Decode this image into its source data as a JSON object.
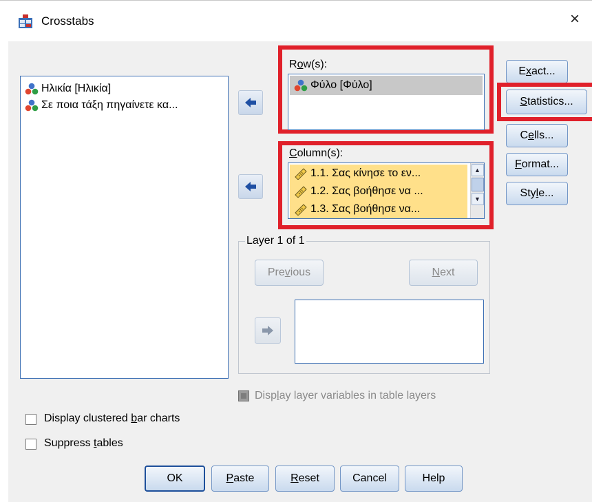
{
  "window": {
    "title": "Crosstabs",
    "close_glyph": "×"
  },
  "source_list": {
    "items": [
      {
        "label": "Ηλικία [Ηλικία]",
        "icon": "nominal-variable-icon"
      },
      {
        "label": "Σε ποια τάξη πηγαίνετε κα...",
        "icon": "nominal-variable-icon"
      }
    ]
  },
  "rows": {
    "label_pre": "R",
    "label_ul": "o",
    "label_post": "w(s):",
    "items": [
      {
        "label": "Φύλο [Φύλο]",
        "icon": "nominal-variable-icon",
        "selected": true
      }
    ]
  },
  "columns": {
    "label_pre": "",
    "label_ul": "C",
    "label_post": "olumn(s):",
    "items": [
      {
        "label": "1.1. Σας κίνησε το εν...",
        "icon": "scale-ruler-icon"
      },
      {
        "label": "1.2. Σας βοήθησε να ...",
        "icon": "scale-ruler-icon"
      },
      {
        "label": "1.3. Σας βοήθησε να...",
        "icon": "scale-ruler-icon"
      }
    ]
  },
  "side_buttons": {
    "exact": {
      "pre": "E",
      "ul": "x",
      "post": "act..."
    },
    "statistics": {
      "pre": "",
      "ul": "S",
      "post": "tatistics..."
    },
    "cells": {
      "pre": "C",
      "ul": "e",
      "post": "lls..."
    },
    "format": {
      "pre": "",
      "ul": "F",
      "post": "ormat..."
    },
    "style": {
      "pre": "Sty",
      "ul": "l",
      "post": "e..."
    }
  },
  "layer": {
    "title": "Layer 1 of 1",
    "previous": {
      "pre": "Pre",
      "ul": "v",
      "post": "ious"
    },
    "next": {
      "pre": "",
      "ul": "N",
      "post": "ext"
    }
  },
  "options": {
    "display_layer": {
      "pre": "Disp",
      "ul": "l",
      "post": "ay layer variables in table layers",
      "checked": false,
      "enabled": false
    },
    "clustered_bar": {
      "pre": "Display clustered ",
      "ul": "b",
      "post": "ar charts",
      "checked": false
    },
    "suppress_tables": {
      "pre": "Suppress ",
      "ul": "t",
      "post": "ables",
      "checked": false
    }
  },
  "footer": {
    "ok": {
      "pre": "OK",
      "ul": "",
      "post": ""
    },
    "paste": {
      "pre": "",
      "ul": "P",
      "post": "aste"
    },
    "reset": {
      "pre": "",
      "ul": "R",
      "post": "eset"
    },
    "cancel": {
      "pre": "Cancel",
      "ul": "",
      "post": ""
    },
    "help": {
      "pre": "Help",
      "ul": "",
      "post": ""
    }
  },
  "colors": {
    "highlight": "#e0202a",
    "selected_row": "#c8c8c8",
    "column_items": "#ffe08a",
    "button_border": "#7396c6"
  }
}
